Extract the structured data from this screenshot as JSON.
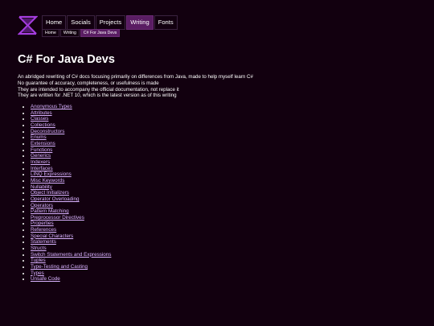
{
  "nav": {
    "items": [
      {
        "label": "Home",
        "active": false
      },
      {
        "label": "Socials",
        "active": false
      },
      {
        "label": "Projects",
        "active": false
      },
      {
        "label": "Writing",
        "active": true
      },
      {
        "label": "Fonts",
        "active": false
      }
    ]
  },
  "breadcrumb": [
    "Home",
    "Writing",
    "C# For Java Devs"
  ],
  "page": {
    "title": "C# For Java Devs",
    "intro": [
      "An abridged rewriting of C# docs focusing primarily on differences from Java, made to help myself learn C#",
      "No guarantee of accuracy, completeness, or usefulness is made",
      "They are intended to accompany the official documentation, not replace it",
      "They are written for .NET 10, which is the latest version as of this writing"
    ],
    "topics": [
      "Anonymous Types",
      "Attributes",
      "Classes",
      "Collections",
      "Deconstructors",
      "Enums",
      "Extensions",
      "Functions",
      "Generics",
      "Indexers",
      "Interfaces",
      "LINQ Expressions",
      "Misc Keywords",
      "Nullability",
      "Object Initializers",
      "Operator Overloading",
      "Operators",
      "Pattern Matching",
      "Preprocessor Directives",
      "Properties",
      "References",
      "Special Characters",
      "Statements",
      "Structs",
      "Switch Statements and Expressions",
      "Tuples",
      "Type-Testing and Casting",
      "Types",
      "Unsafe Code"
    ]
  },
  "colors": {
    "background": "#12000f",
    "accent": "#5a1d63",
    "link": "#d9b3ff",
    "logo": "#a63ee0"
  },
  "icons": {
    "logo": "hourglass-x-logo-icon"
  }
}
